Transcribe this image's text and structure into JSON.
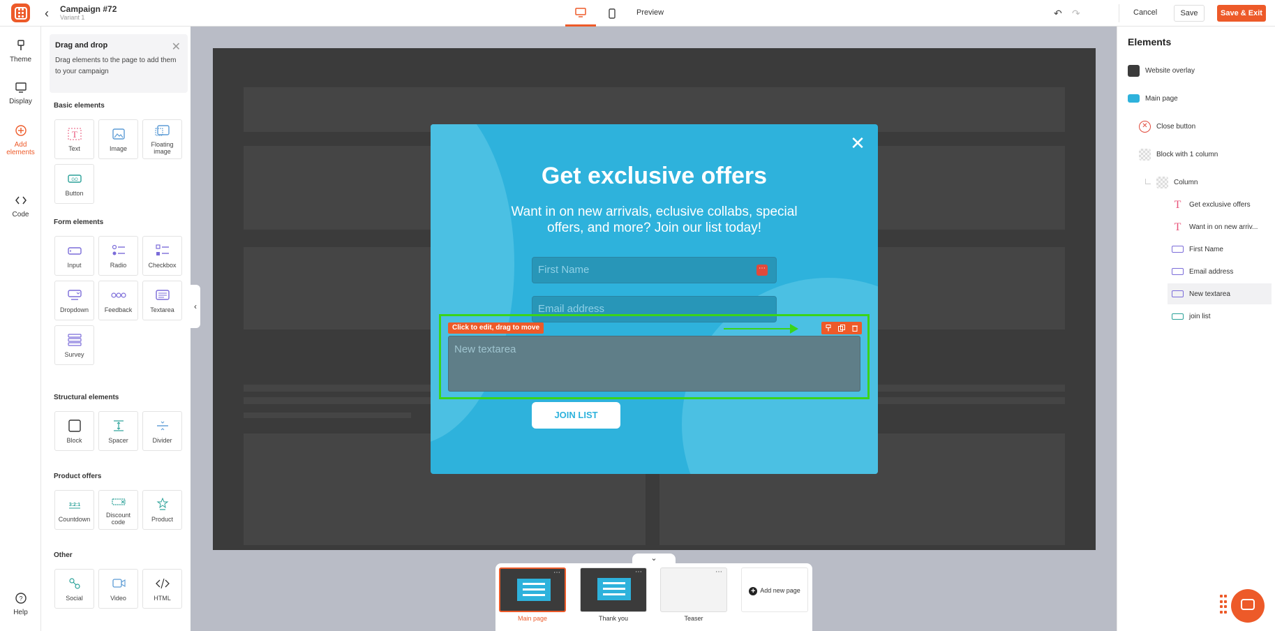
{
  "header": {
    "campaign_title": "Campaign #72",
    "variant": "Variant 1",
    "preview": "Preview",
    "cancel": "Cancel",
    "save": "Save",
    "save_exit": "Save & Exit",
    "accent_color": "#ed5a29"
  },
  "rail": {
    "theme": "Theme",
    "display": "Display",
    "add_elements_1": "Add",
    "add_elements_2": "elements",
    "code": "Code",
    "help": "Help"
  },
  "panel": {
    "dnd_title": "Drag and drop",
    "dnd_desc": "Drag elements to the page to add them to your campaign",
    "basic_title": "Basic elements",
    "basic": [
      "Text",
      "Image",
      "Floating image",
      "Button"
    ],
    "form_title": "Form elements",
    "form": [
      "Input",
      "Radio",
      "Checkbox",
      "Dropdown",
      "Feedback",
      "Textarea",
      "Survey"
    ],
    "structural_title": "Structural elements",
    "structural": [
      "Block",
      "Spacer",
      "Divider"
    ],
    "product_title": "Product offers",
    "product": [
      "Countdown",
      "Discount code",
      "Product"
    ],
    "other_title": "Other",
    "other": [
      "Social",
      "Video",
      "HTML"
    ],
    "countdown_icon_text": "3:2:1",
    "button_icon_text": "GO"
  },
  "popup": {
    "title": "Get exclusive offers",
    "subtitle": "Want in on new arrivals, eclusive collabs, special offers, and more? Join our list today!",
    "first_name_placeholder": "First Name",
    "email_placeholder": "Email address",
    "textarea_placeholder": "New textarea",
    "drag_hint": "Click to edit, drag to move",
    "join_button": "JOIN LIST",
    "bg_color": "#2eb2dc",
    "select_color": "#3ad41a"
  },
  "pages": {
    "items": [
      "Main page",
      "Thank you",
      "Teaser"
    ],
    "add_new": "Add new page"
  },
  "elements_panel": {
    "title": "Elements",
    "tree": [
      "Website overlay",
      "Main page",
      "Close button",
      "Block with 1 column",
      "Column",
      "Get exclusive offers",
      "Want in on new arriv...",
      "First Name",
      "Email address",
      "New textarea",
      "join list"
    ]
  }
}
